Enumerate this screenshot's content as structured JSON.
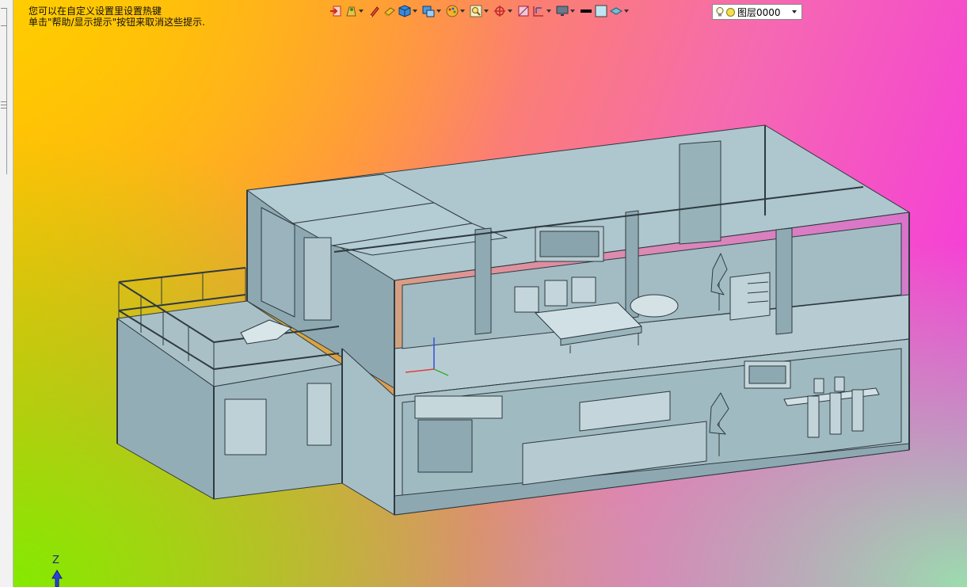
{
  "hints": {
    "line1": "您可以在自定义设置里设置热键",
    "line2": "单击\"帮助/显示提示\"按钮来取消这些提示."
  },
  "toolbar": {
    "items": [
      {
        "icon": "exit-sketch-icon",
        "dropdown": false
      },
      {
        "icon": "render-style-icon",
        "dropdown": true
      },
      {
        "icon": "pen-draw-icon",
        "dropdown": false
      },
      {
        "icon": "eraser-icon",
        "dropdown": false
      },
      {
        "icon": "cube-view-icon",
        "dropdown": true
      },
      {
        "icon": "display-mode-icon",
        "dropdown": true
      },
      {
        "icon": "palette-icon",
        "dropdown": true
      },
      {
        "icon": "zoom-fit-icon",
        "dropdown": true
      },
      {
        "icon": "rotate-pan-icon",
        "dropdown": true
      },
      {
        "icon": "section-view-icon",
        "dropdown": false
      },
      {
        "icon": "dimension-icon",
        "dropdown": true
      },
      {
        "icon": "monitor-view-icon",
        "dropdown": true
      },
      {
        "icon": "line-weight-icon",
        "dropdown": false
      },
      {
        "icon": "fill-color-icon",
        "dropdown": false
      },
      {
        "icon": "layer-visibility-icon",
        "dropdown": true
      }
    ]
  },
  "layer": {
    "name": "图层0000"
  },
  "axis": {
    "z_label": "Z"
  },
  "colors": {
    "model_face": "#9fb9c2",
    "model_edge": "#2e3a40"
  }
}
